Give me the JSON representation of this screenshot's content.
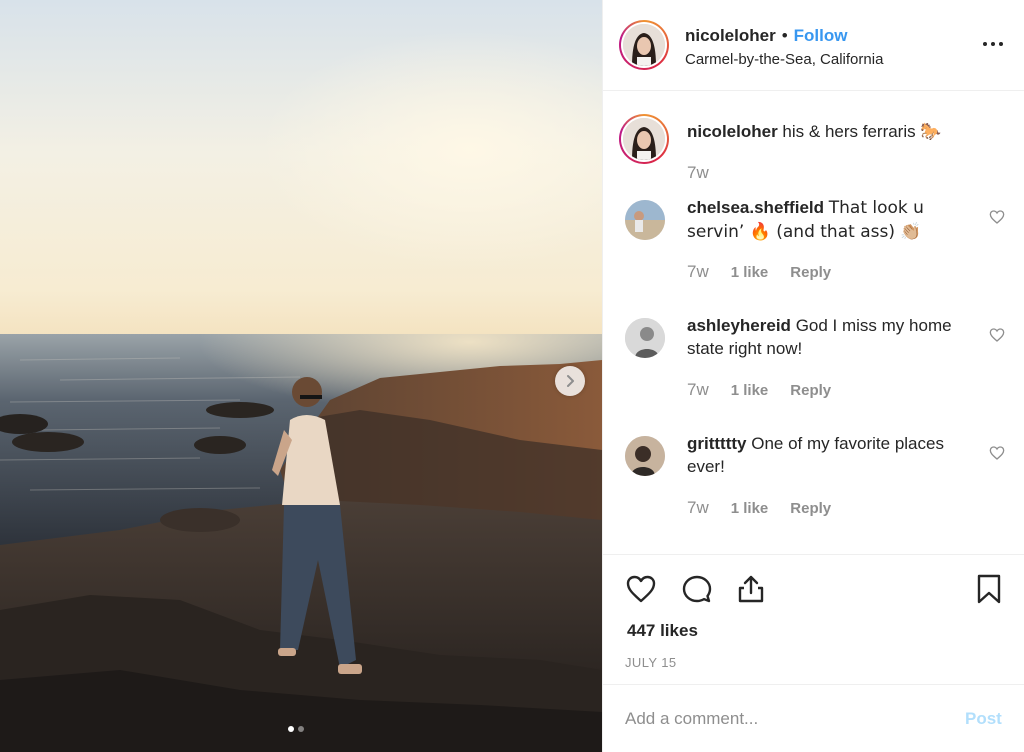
{
  "post": {
    "username": "nicoleloher",
    "dot": "•",
    "follow_label": "Follow",
    "location": "Carmel-by-the-Sea, California",
    "more_icon": "more-options-icon",
    "carousel": {
      "current": 1,
      "total": 2
    },
    "caption": {
      "username": "nicoleloher",
      "text": "his & hers ferraris",
      "emoji": "🐎",
      "time": "7w"
    },
    "comments": [
      {
        "username": "chelsea.sheffield",
        "text": "That look u servin’ 🔥 (and that ass) 👏🏼",
        "time": "7w",
        "likes": "1 like",
        "reply": "Reply"
      },
      {
        "username": "ashleyhereid",
        "text": "God I miss my home state right now!",
        "time": "7w",
        "likes": "1 like",
        "reply": "Reply"
      },
      {
        "username": "grittttty",
        "text": "One of my favorite places ever!",
        "time": "7w",
        "likes": "1 like",
        "reply": "Reply"
      }
    ],
    "likes": "447 likes",
    "date": "JULY 15",
    "add_comment": {
      "placeholder": "Add a comment...",
      "post_label": "Post"
    }
  },
  "colors": {
    "link": "#3897f0",
    "text": "#262626",
    "muted": "#8e8e8e",
    "post_disabled": "#b2dffc"
  }
}
